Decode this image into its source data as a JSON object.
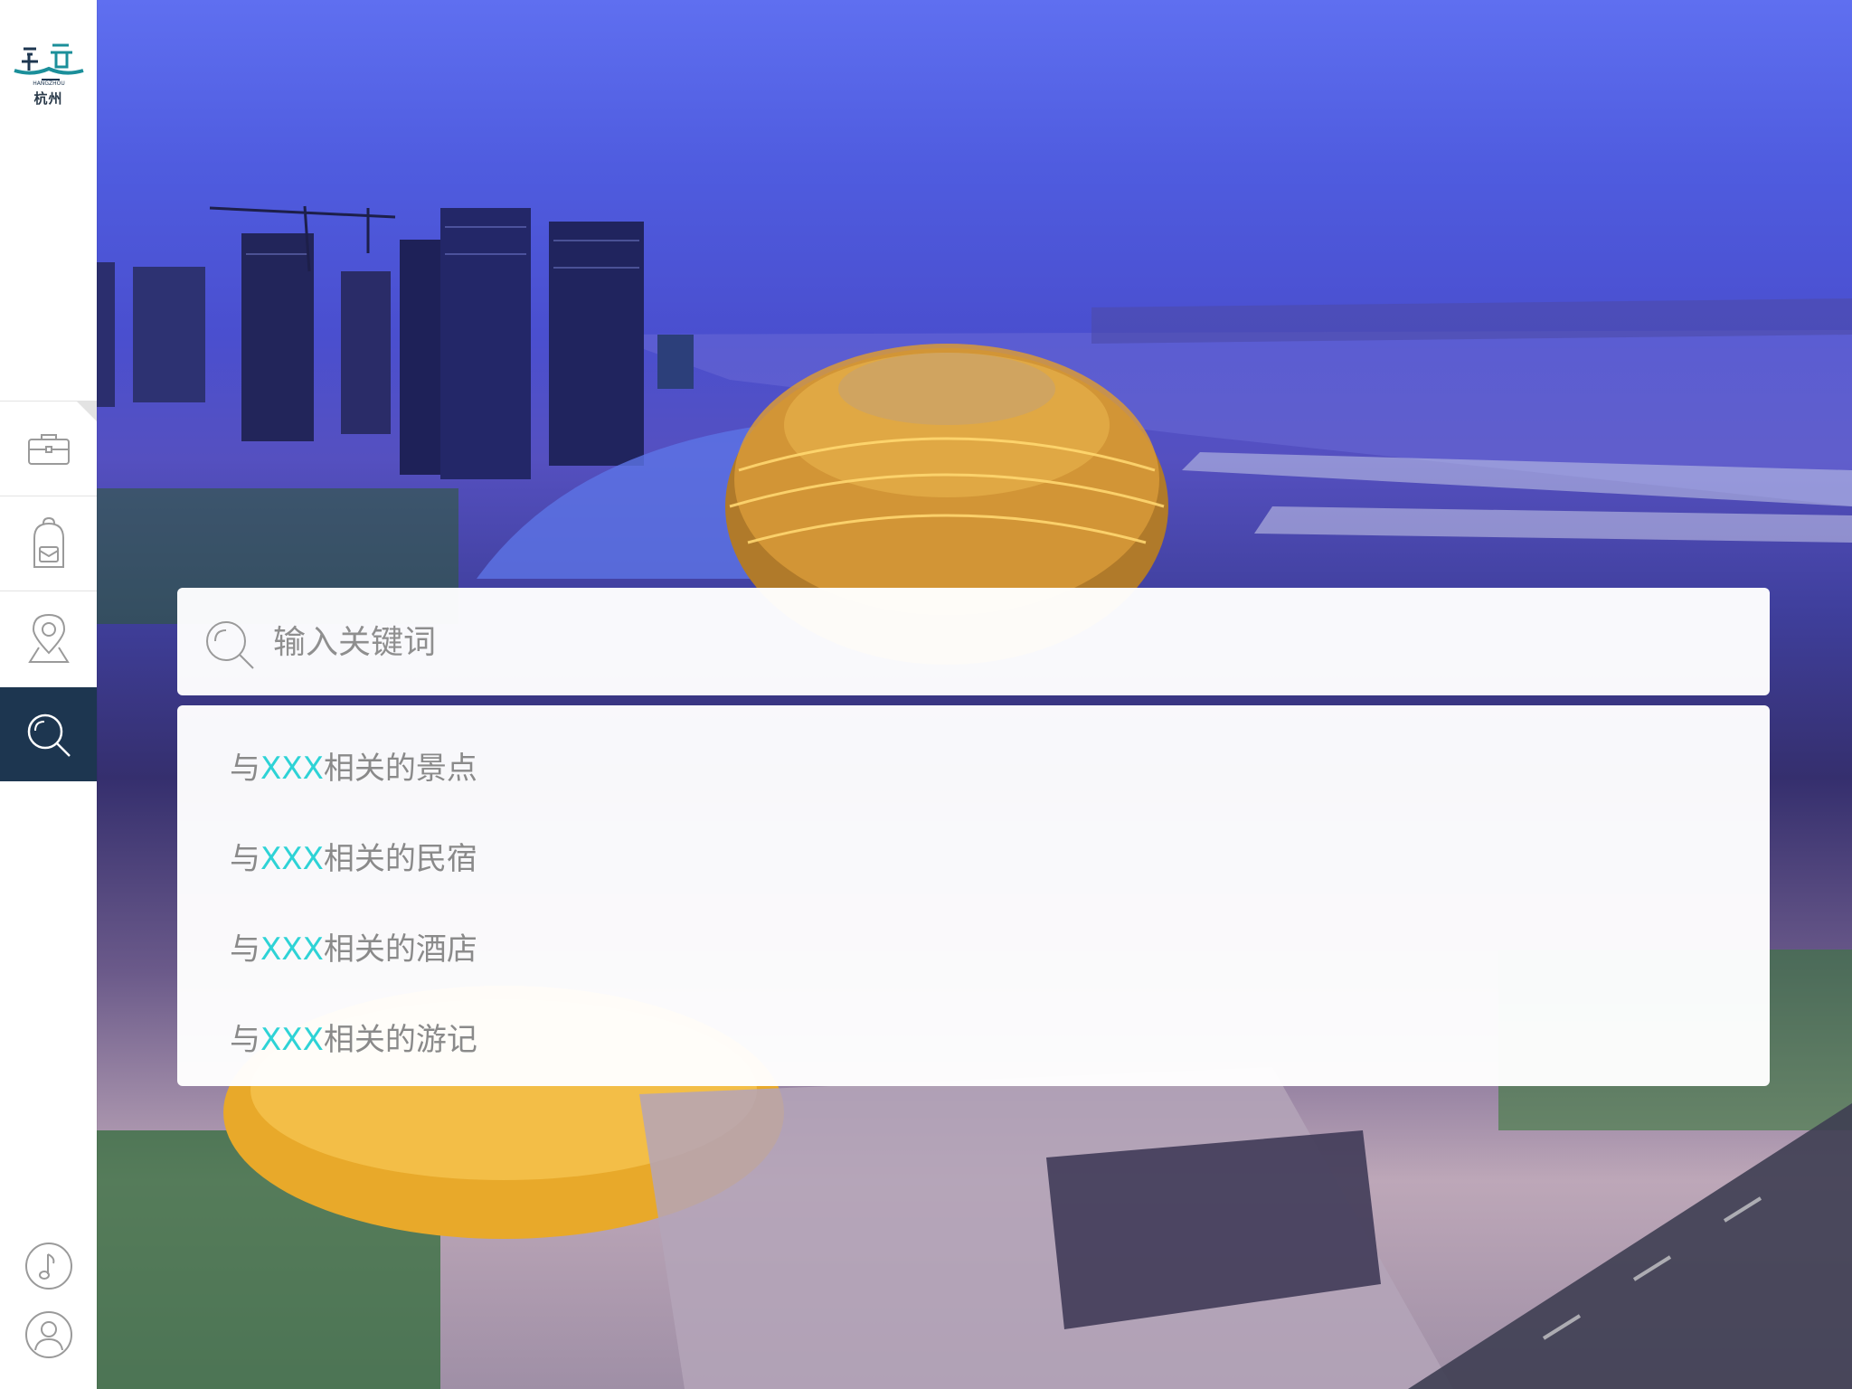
{
  "brand": {
    "logo_text": "杭州",
    "logo_subtext": "HANGZHOU"
  },
  "sidebar": {
    "items": [
      {
        "name": "briefcase",
        "icon": "briefcase-icon",
        "active": false
      },
      {
        "name": "backpack",
        "icon": "backpack-icon",
        "active": false
      },
      {
        "name": "location",
        "icon": "map-pin-icon",
        "active": false
      },
      {
        "name": "search",
        "icon": "search-icon",
        "active": true
      }
    ],
    "bottom": [
      {
        "name": "music",
        "icon": "music-note-icon"
      },
      {
        "name": "user",
        "icon": "user-icon"
      }
    ]
  },
  "search": {
    "placeholder": "输入关键词",
    "value": ""
  },
  "suggestions": [
    {
      "prefix": "与",
      "keyword": "XXX",
      "suffix": "相关的景点"
    },
    {
      "prefix": "与",
      "keyword": "XXX",
      "suffix": "相关的民宿"
    },
    {
      "prefix": "与",
      "keyword": "XXX",
      "suffix": "相关的酒店"
    },
    {
      "prefix": "与",
      "keyword": "XXX",
      "suffix": "相关的游记"
    }
  ],
  "colors": {
    "sidebar_active": "#1d3650",
    "keyword_highlight": "#2ed3d6",
    "suggestion_text": "#8a8a8a"
  }
}
